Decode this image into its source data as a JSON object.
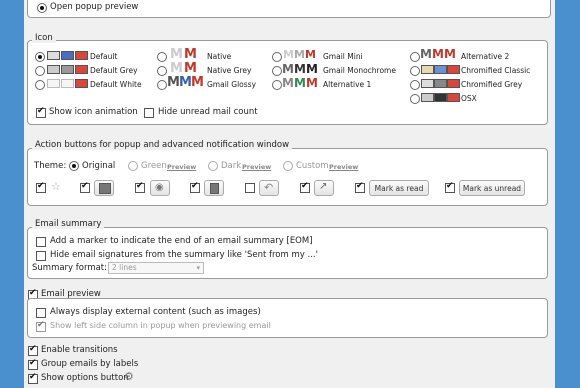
{
  "top": {
    "open_popup_preview": "Open popup preview"
  },
  "icon_section": {
    "title": "Icon",
    "options": [
      {
        "label": "Default",
        "selected": true
      },
      {
        "label": "Native",
        "selected": false
      },
      {
        "label": "Gmail Mini",
        "selected": false
      },
      {
        "label": "Alternative 2",
        "selected": false
      },
      {
        "label": "Default Grey",
        "selected": false
      },
      {
        "label": "Native Grey",
        "selected": false
      },
      {
        "label": "Gmail Monochrome",
        "selected": false
      },
      {
        "label": "Chromified Classic",
        "selected": false
      },
      {
        "label": "Default White",
        "selected": false
      },
      {
        "label": "Gmail Glossy",
        "selected": false
      },
      {
        "label": "Alternative 1",
        "selected": false
      },
      {
        "label": "Chromified Grey",
        "selected": false
      },
      {
        "label": "OSX",
        "selected": false
      }
    ],
    "show_icon_animation": "Show icon animation",
    "hide_unread_count": "Hide unread mail count"
  },
  "actions_section": {
    "title": "Action buttons for popup and advanced notification window",
    "theme_label": "Theme:",
    "themes": [
      {
        "label": "Original",
        "selected": true,
        "disabled": false
      },
      {
        "label": "Green",
        "selected": false,
        "disabled": true,
        "preview": "Preview"
      },
      {
        "label": "Dark",
        "selected": false,
        "disabled": true,
        "preview": "Preview"
      },
      {
        "label": "Custom",
        "selected": false,
        "disabled": true,
        "preview": "Preview"
      }
    ],
    "mark_as_read": "Mark as read",
    "mark_as_unread": "Mark as unread"
  },
  "email_summary": {
    "title": "Email summary",
    "add_marker": "Add a marker to indicate the end of an email summary [EOM]",
    "hide_signatures": "Hide email signatures from the summary like 'Sent from my ...'",
    "format_label": "Summary format:",
    "format_value": "2 lines"
  },
  "email_preview": {
    "title": "Email preview",
    "always_display": "Always display external content (such as images)",
    "show_left_column": "Show left side column in popup when previewing email"
  },
  "bottom": {
    "enable_transitions": "Enable transitions",
    "group_by_labels": "Group emails by labels",
    "show_options_button": "Show options button"
  },
  "colors": {
    "background": "#4a8fce",
    "gmail_red": "#c0392b",
    "envelope_blue": "#3b5fa8"
  }
}
